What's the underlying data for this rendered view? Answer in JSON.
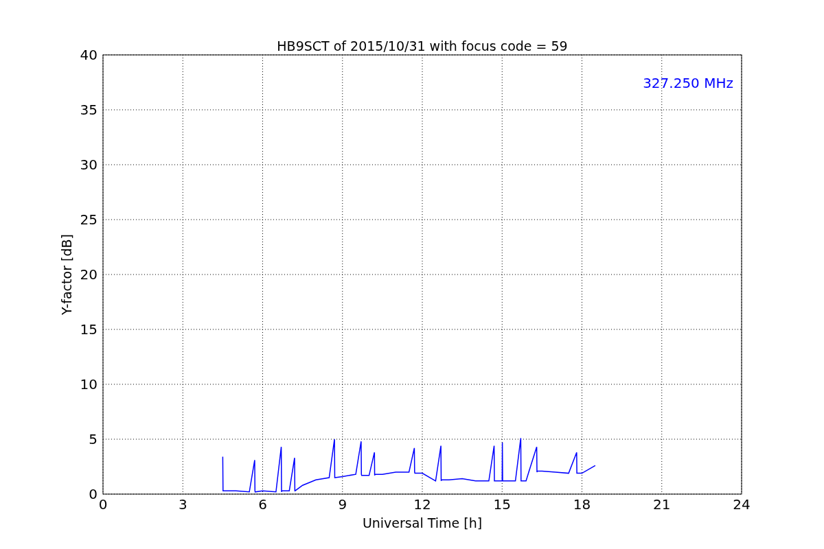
{
  "chart_data": {
    "type": "line",
    "title": "HB9SCT of 2015/10/31 with focus code = 59",
    "xlabel": "Universal Time [h]",
    "ylabel": "Y-factor [dB]",
    "x": [
      4.5,
      4.51,
      4.52,
      5,
      5.5,
      5.7,
      5.71,
      5.72,
      6,
      6.5,
      6.7,
      6.71,
      6.72,
      7,
      7.2,
      7.21,
      7.22,
      7.5,
      8,
      8.5,
      8.7,
      8.71,
      8.72,
      9,
      9.5,
      9.7,
      9.71,
      9.72,
      10,
      10.2,
      10.21,
      10.22,
      10.5,
      11,
      11.5,
      11.7,
      11.71,
      11.72,
      12,
      12.5,
      12.7,
      12.71,
      12.72,
      13,
      13.5,
      14,
      14.5,
      14.7,
      14.71,
      14.72,
      15,
      15.01,
      15.02,
      15.5,
      15.7,
      15.71,
      15.72,
      15.9,
      16,
      16.3,
      16.31,
      16.32,
      16.5,
      17,
      17.5,
      17.8,
      17.81,
      17.82,
      18,
      18.5
    ],
    "series": [
      {
        "name": "327.250 MHz",
        "color": "#0000ff",
        "values": [
          3.4,
          0.3,
          0.3,
          0.3,
          0.2,
          3.1,
          0.3,
          0.2,
          0.3,
          0.2,
          4.3,
          0.2,
          0.3,
          0.3,
          3.3,
          0.3,
          0.3,
          0.8,
          1.3,
          1.5,
          5.0,
          1.5,
          1.5,
          1.6,
          1.8,
          4.8,
          1.8,
          1.7,
          1.7,
          3.8,
          1.7,
          1.8,
          1.8,
          2.0,
          2.0,
          4.2,
          2.0,
          1.9,
          1.9,
          1.2,
          4.4,
          1.2,
          1.3,
          1.3,
          1.4,
          1.2,
          1.2,
          4.4,
          1.2,
          1.2,
          1.2,
          4.7,
          1.2,
          1.2,
          5.1,
          1.2,
          1.2,
          1.2,
          2.0,
          4.3,
          2.0,
          2.1,
          2.1,
          2.0,
          1.9,
          3.8,
          1.9,
          1.9,
          1.9,
          2.6
        ]
      }
    ],
    "xlim": [
      0,
      24
    ],
    "ylim": [
      0,
      40
    ],
    "xticks": [
      0,
      3,
      6,
      9,
      12,
      15,
      18,
      21,
      24
    ],
    "yticks": [
      0,
      5,
      10,
      15,
      20,
      25,
      30,
      35,
      40
    ],
    "grid": true
  }
}
